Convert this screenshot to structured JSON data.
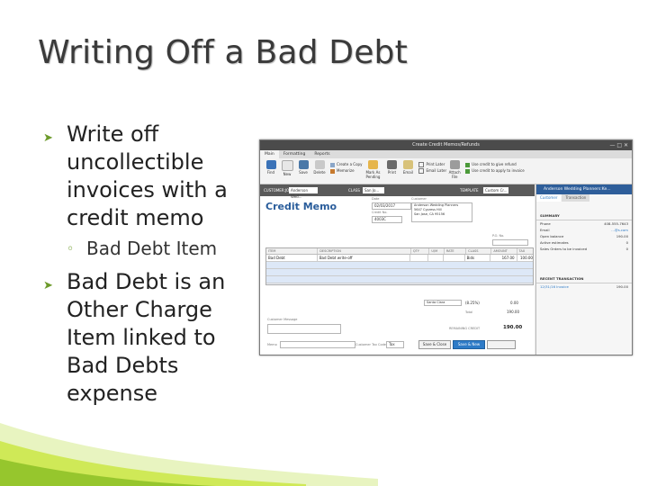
{
  "slide": {
    "title": "Writing Off a Bad Debt",
    "bullets": [
      {
        "text": "Write off uncollectible invoices with a credit memo",
        "sub": "Bad Debt Item"
      },
      {
        "text": "Bad Debt is an Other Charge Item linked to Bad Debts expense"
      }
    ]
  },
  "window": {
    "title": "Create Credit Memos/Refunds",
    "tabs": [
      "Main",
      "Formatting",
      "Reports"
    ],
    "ribbon": {
      "buttons": [
        "Find",
        "New",
        "Save",
        "Delete",
        "Mark As Pending",
        "Print",
        "Email",
        "Attach File"
      ],
      "create_copy": "Create a Copy",
      "memorize": "Memorize",
      "print_later": "Print Later",
      "email_later": "Email Later",
      "use_credit_refund": "Use credit to give refund",
      "use_credit_apply": "Use credit to apply to invoice"
    },
    "customer_job_label": "CUSTOMER:JOB",
    "customer_job_value": "Anderson Wed...",
    "class_label": "CLASS",
    "class_value": "San Jo...",
    "template_label": "TEMPLATE",
    "template_value": "Custom Cr...",
    "form_title": "Credit Memo",
    "date_label": "Date",
    "date_value": "02/03/2017",
    "credit_no_label": "Credit No.",
    "credit_no_value": "4003C",
    "customer_label": "Customer",
    "customer_address": [
      "Anderson Wedding Planners",
      "5647 Cypress Hill",
      "San Jose, CA 95156"
    ],
    "po_label": "P.O. No.",
    "columns": [
      "ITEM",
      "DESCRIPTION",
      "QTY",
      "U/M",
      "RATE",
      "CLASS",
      "AMOUNT",
      "TAX"
    ],
    "rows": [
      {
        "item": "Bad Debt",
        "description": "Bad Debt write-off",
        "qty": "",
        "um": "",
        "rate": "",
        "class": "Bids",
        "amount": "167.00",
        "tax": "100.00"
      }
    ],
    "customer_message_label": "Customer Message",
    "tax_item": "Santa Clara",
    "tax_pct": "(8.25%)",
    "tax_value": "0.00",
    "total_label": "Total",
    "total_value": "190.00",
    "remaining_label": "REMAINING CREDIT",
    "remaining_value": "190.00",
    "memo_label": "Memo",
    "customer_tax_code_label": "Customer Tax Code",
    "customer_tax_code": "Tax",
    "save_close": "Save & Close",
    "save_new": "Save & New",
    "side": {
      "header": "Anderson Wedding Planners:Ke...",
      "tabs": [
        "Customer",
        "Transaction"
      ],
      "summary_label": "SUMMARY",
      "rows": [
        {
          "label": "Phone",
          "value": "408-555-7643"
        },
        {
          "label": "Email",
          "value": "...@s.com"
        },
        {
          "label": "Open balance",
          "value": "190.00"
        },
        {
          "label": "Active estimates",
          "value": "0"
        },
        {
          "label": "Sales Orders to be invoiced",
          "value": "0"
        }
      ],
      "recent_label": "RECENT TRANSACTION",
      "recent": [
        {
          "label": "12/31/16 Invoice",
          "value": "190.00"
        }
      ]
    }
  },
  "colors": {
    "accent": "#2e7bc7",
    "bullet": "#6c9a2a",
    "deco_green": "#c8e63c"
  }
}
